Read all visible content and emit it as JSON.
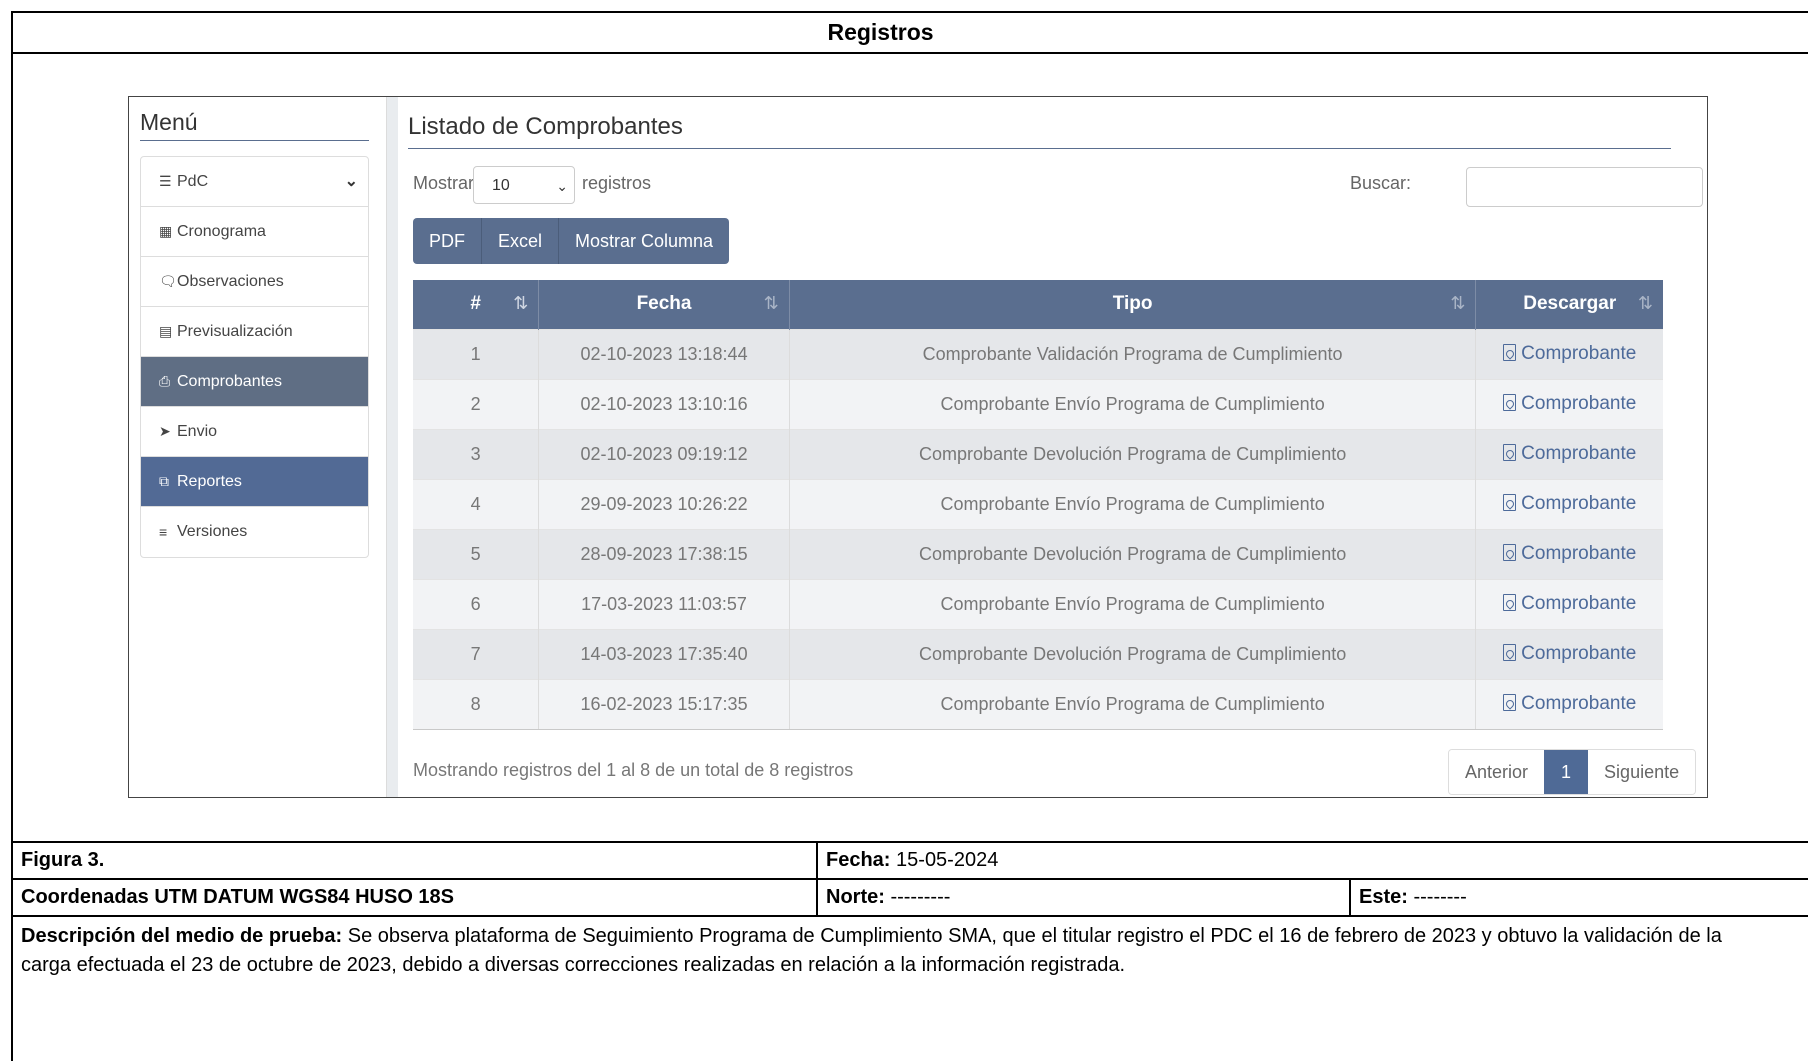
{
  "document": {
    "title": "Registros",
    "figure_label": "Figura 3.",
    "fecha_label": "Fecha:",
    "fecha_value": "15-05-2024",
    "coords_label": "Coordenadas UTM DATUM WGS84 HUSO 18S",
    "norte_label": "Norte:",
    "norte_value": "---------",
    "este_label": "Este:",
    "este_value": "--------",
    "desc_label": "Descripción del medio de prueba:",
    "desc_text": "Se observa plataforma de Seguimiento Programa de Cumplimiento SMA, que el titular registro el PDC el 16 de febrero de 2023 y obtuvo la validación de la carga efectuada el 23 de octubre de 2023, debido a diversas correcciones realizadas en relación a la información registrada."
  },
  "sidebar": {
    "title": "Menú",
    "items": [
      {
        "label": "PdC",
        "icon": "bars-icon"
      },
      {
        "label": "Cronograma",
        "icon": "calendar-icon"
      },
      {
        "label": "Observaciones",
        "icon": "comment-icon"
      },
      {
        "label": "Previsualización",
        "icon": "list-alt-icon"
      },
      {
        "label": "Comprobantes",
        "icon": "file-pdf-icon"
      },
      {
        "label": "Envio",
        "icon": "send-icon"
      },
      {
        "label": "Reportes",
        "icon": "copy-icon"
      },
      {
        "label": "Versiones",
        "icon": "list-ol-icon"
      }
    ]
  },
  "main": {
    "title": "Listado de Comprobantes",
    "show_label": "Mostrar",
    "show_value": "10",
    "records_label": "registros",
    "search_label": "Buscar:",
    "search_value": "",
    "buttons": [
      "PDF",
      "Excel",
      "Mostrar Columna"
    ],
    "columns": [
      "#",
      "Fecha",
      "Tipo",
      "Descargar"
    ],
    "rows": [
      {
        "n": "1",
        "fecha": "02-10-2023 13:18:44",
        "tipo": "Comprobante Validación Programa de Cumplimiento",
        "link": "Comprobante"
      },
      {
        "n": "2",
        "fecha": "02-10-2023 13:10:16",
        "tipo": "Comprobante Envío Programa de Cumplimiento",
        "link": "Comprobante"
      },
      {
        "n": "3",
        "fecha": "02-10-2023 09:19:12",
        "tipo": "Comprobante Devolución Programa de Cumplimiento",
        "link": "Comprobante"
      },
      {
        "n": "4",
        "fecha": "29-09-2023 10:26:22",
        "tipo": "Comprobante Envío Programa de Cumplimiento",
        "link": "Comprobante"
      },
      {
        "n": "5",
        "fecha": "28-09-2023 17:38:15",
        "tipo": "Comprobante Devolución Programa de Cumplimiento",
        "link": "Comprobante"
      },
      {
        "n": "6",
        "fecha": "17-03-2023 11:03:57",
        "tipo": "Comprobante Envío Programa de Cumplimiento",
        "link": "Comprobante"
      },
      {
        "n": "7",
        "fecha": "14-03-2023 17:35:40",
        "tipo": "Comprobante Devolución Programa de Cumplimiento",
        "link": "Comprobante"
      },
      {
        "n": "8",
        "fecha": "16-02-2023 15:17:35",
        "tipo": "Comprobante Envío Programa de Cumplimiento",
        "link": "Comprobante"
      }
    ],
    "info": "Mostrando registros del 1 al 8 de un total de 8 registros",
    "pager": {
      "prev": "Anterior",
      "current": "1",
      "next": "Siguiente"
    }
  }
}
